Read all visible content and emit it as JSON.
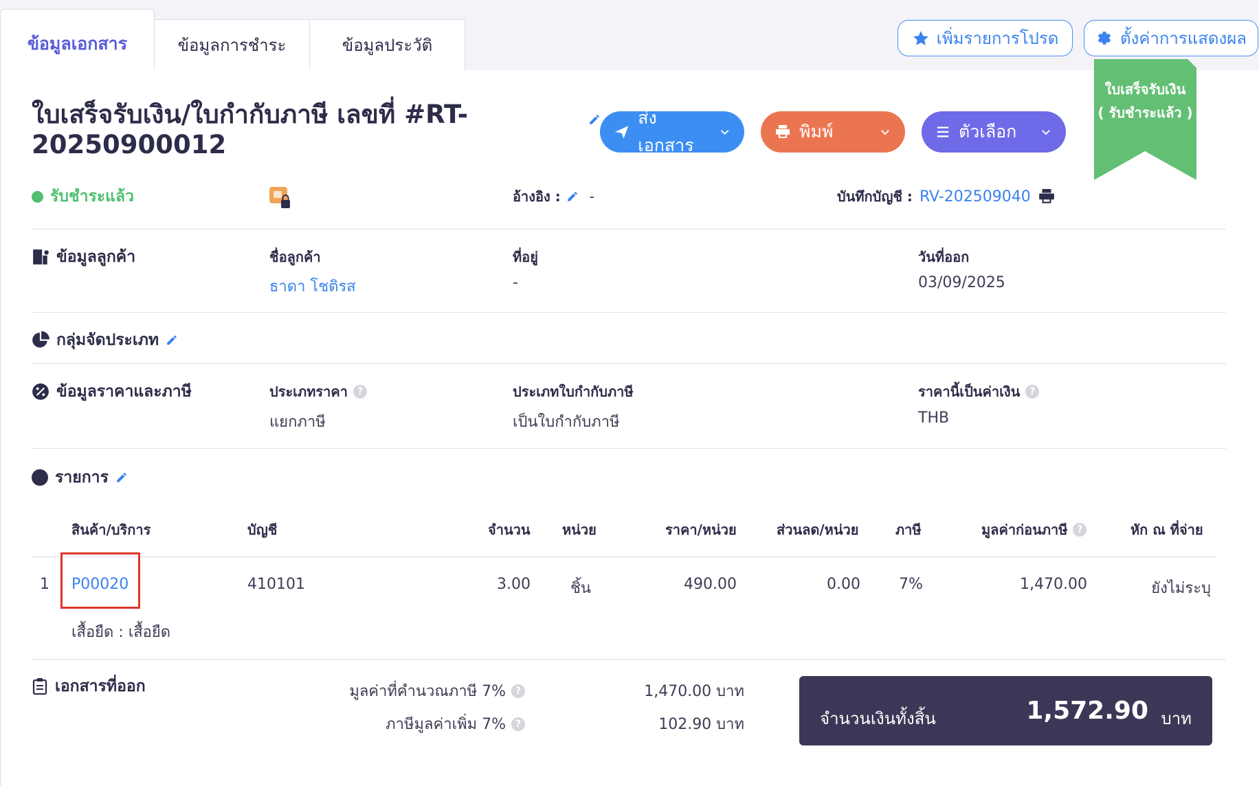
{
  "tabs": [
    {
      "label": "ข้อมูลเอกสาร",
      "active": true
    },
    {
      "label": "ข้อมูลการชำระ",
      "active": false
    },
    {
      "label": "ข้อมูลประวัติ",
      "active": false
    }
  ],
  "top_actions": {
    "favorite_label": "เพิ่มรายการโปรด",
    "display_settings_label": "ตั้งค่าการแสดงผล"
  },
  "document": {
    "title": "ใบเสร็จรับเงิน/ใบกำกับภาษี เลขที่ #RT-20250900012",
    "status": "รับชำระแล้ว",
    "ribbon_line1": "ใบเสร็จรับเงิน",
    "ribbon_line2": "( รับชำระแล้ว )",
    "reference_label": "อ้างอิง :",
    "reference_value": "-",
    "journal_label": "บันทึกบัญชี :",
    "journal_value": "RV-202509040"
  },
  "actions": {
    "send_label": "ส่งเอกสาร",
    "print_label": "พิมพ์",
    "options_label": "ตัวเลือก"
  },
  "customer": {
    "section_title": "ข้อมูลลูกค้า",
    "name_label": "ชื่อลูกค้า",
    "name_value": "ธาดา โชติรส",
    "address_label": "ที่อยู่",
    "address_value": "-",
    "issue_date_label": "วันที่ออก",
    "issue_date_value": "03/09/2025"
  },
  "classification": {
    "section_title": "กลุ่มจัดประเภท"
  },
  "pricing": {
    "section_title": "ข้อมูลราคาและภาษี",
    "price_type_label": "ประเภทราคา",
    "price_type_value": "แยกภาษี",
    "tax_invoice_type_label": "ประเภทใบกำกับภาษี",
    "tax_invoice_type_value": "เป็นใบกำกับภาษี",
    "currency_label": "ราคานี้เป็นค่าเงิน",
    "currency_value": "THB"
  },
  "items": {
    "section_title": "รายการ",
    "headers": {
      "product": "สินค้า/บริการ",
      "account": "บัญชี",
      "qty": "จำนวน",
      "unit": "หน่วย",
      "price": "ราคา/หน่วย",
      "discount": "ส่วนลด/หน่วย",
      "tax": "ภาษี",
      "pretax": "มูลค่าก่อนภาษี",
      "withholding": "หัก ณ ที่จ่าย"
    },
    "rows": [
      {
        "index": "1",
        "product_code": "P00020",
        "description": "เสื้อยืด : เสื้อยืด",
        "account": "410101",
        "qty": "3.00",
        "unit": "ชิ้น",
        "price": "490.00",
        "discount": "0.00",
        "tax": "7%",
        "pretax": "1,470.00",
        "withholding": "ยังไม่ระบุ"
      }
    ]
  },
  "summary": {
    "section_title": "เอกสารที่ออก",
    "taxable_label": "มูลค่าที่คำนวณภาษี 7%",
    "taxable_value": "1,470.00 บาท",
    "vat_label": "ภาษีมูลค่าเพิ่ม 7%",
    "vat_value": "102.90 บาท",
    "total_label": "จำนวนเงินทั้งสิ้น",
    "total_value": "1,572.90",
    "total_currency": "บาท"
  },
  "colors": {
    "primary_blue": "#3d8ef3",
    "print_orange": "#ec7551",
    "options_purple": "#6f6ae7",
    "paid_green": "#4fbf70",
    "total_bg": "#3b3857",
    "highlight_red": "#e03528"
  }
}
